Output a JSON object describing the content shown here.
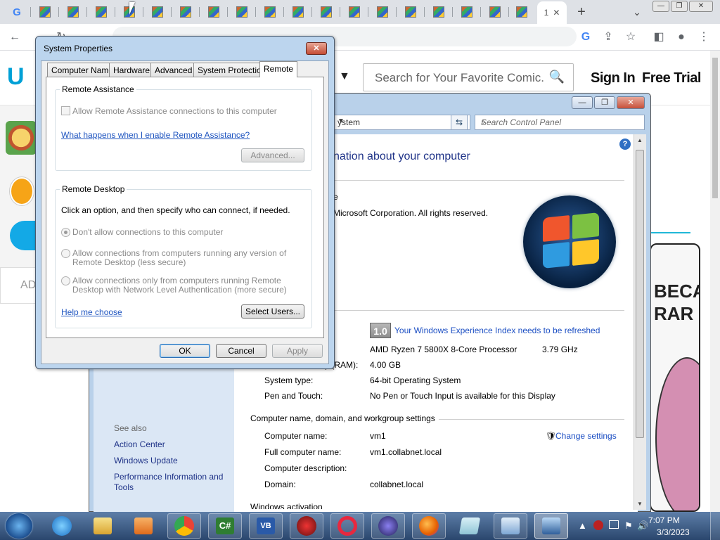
{
  "browser": {
    "active_tab_label": "1",
    "new_tab": "+",
    "tab_search": "⌄",
    "window_minimize": "—",
    "window_restore": "❐",
    "window_close": "✕",
    "back": "←",
    "forward": "→",
    "reload": "↻",
    "toolbar_icons": {
      "google": "G",
      "share": "⇪",
      "star": "☆",
      "sidepanel": "◧",
      "profile": "●",
      "menu": "⋮"
    }
  },
  "site": {
    "logo": "U",
    "nav_chevron": "▼",
    "search_placeholder": "Search for Your Favorite Comic.",
    "search_icon": "🔍",
    "sign_in": "Sign In",
    "free_trial": "Free Trial",
    "ad_text": "AD",
    "comic_text": "BECA RAR"
  },
  "control_panel": {
    "address": "ystem",
    "search_placeholder": "Search Control Panel",
    "heading": "nation about your computer",
    "edition_partial": "e",
    "copyright": "Microsoft Corporation.  All rights reserved.",
    "wei_score": "1.0",
    "wei_link": "Your Windows Experience Index needs to be refreshed",
    "processor": "AMD Ryzen 7 5800X 8-Core Processor",
    "processor_speed": "3.79 GHz",
    "ram_label": "y (RAM):",
    "ram_value": "4.00 GB",
    "system_type_label": "System type:",
    "system_type_value": "64-bit Operating System",
    "pen_label": "Pen and Touch:",
    "pen_value": "No Pen or Touch Input is available for this Display",
    "section_computer": "Computer name, domain, and workgroup settings",
    "computer_name_label": "Computer name:",
    "computer_name_value": "vm1",
    "full_name_label": "Full computer name:",
    "full_name_value": "vm1.collabnet.local",
    "desc_label": "Computer description:",
    "domain_label": "Domain:",
    "domain_value": "collabnet.local",
    "change_settings": "Change settings",
    "section_activation": "Windows activation",
    "see_also": "See also",
    "see_also_items": [
      "Action Center",
      "Windows Update",
      "Performance Information and",
      "Tools"
    ]
  },
  "dialog": {
    "title": "System Properties",
    "close": "✕",
    "tabs": [
      "Computer Name",
      "Hardware",
      "Advanced",
      "System Protection",
      "Remote"
    ],
    "remote_assistance": {
      "group_label": "Remote Assistance",
      "checkbox_label": "Allow Remote Assistance connections to this computer",
      "help_link": "What happens when I enable Remote Assistance?",
      "advanced_button": "Advanced..."
    },
    "remote_desktop": {
      "group_label": "Remote Desktop",
      "instructions": "Click an option, and then specify who can connect, if needed.",
      "option1": "Don't allow connections to this computer",
      "option2_line1": "Allow connections from computers running any version of",
      "option2_line2": "Remote Desktop (less secure)",
      "option3_line1": "Allow connections only from computers running Remote",
      "option3_line2": "Desktop with Network Level Authentication (more secure)",
      "help_link": "Help me choose",
      "select_users_button": "Select Users..."
    },
    "ok_button": "OK",
    "cancel_button": "Cancel",
    "apply_button": "Apply"
  },
  "taskbar": {
    "clock_time": "7:07 PM",
    "clock_date": "3/3/2023",
    "apps": [
      "Internet Explorer",
      "Windows Explorer",
      "Media Player",
      "Google Chrome",
      "C# App",
      "VB App",
      "Red App",
      "Opera",
      "Purple App",
      "Firefox",
      "Notepad",
      "Control Panel",
      "Remote Desktop"
    ],
    "tray_icons": {
      "show_hidden": "▲",
      "flag": "⚑",
      "volume": "🔊"
    }
  }
}
